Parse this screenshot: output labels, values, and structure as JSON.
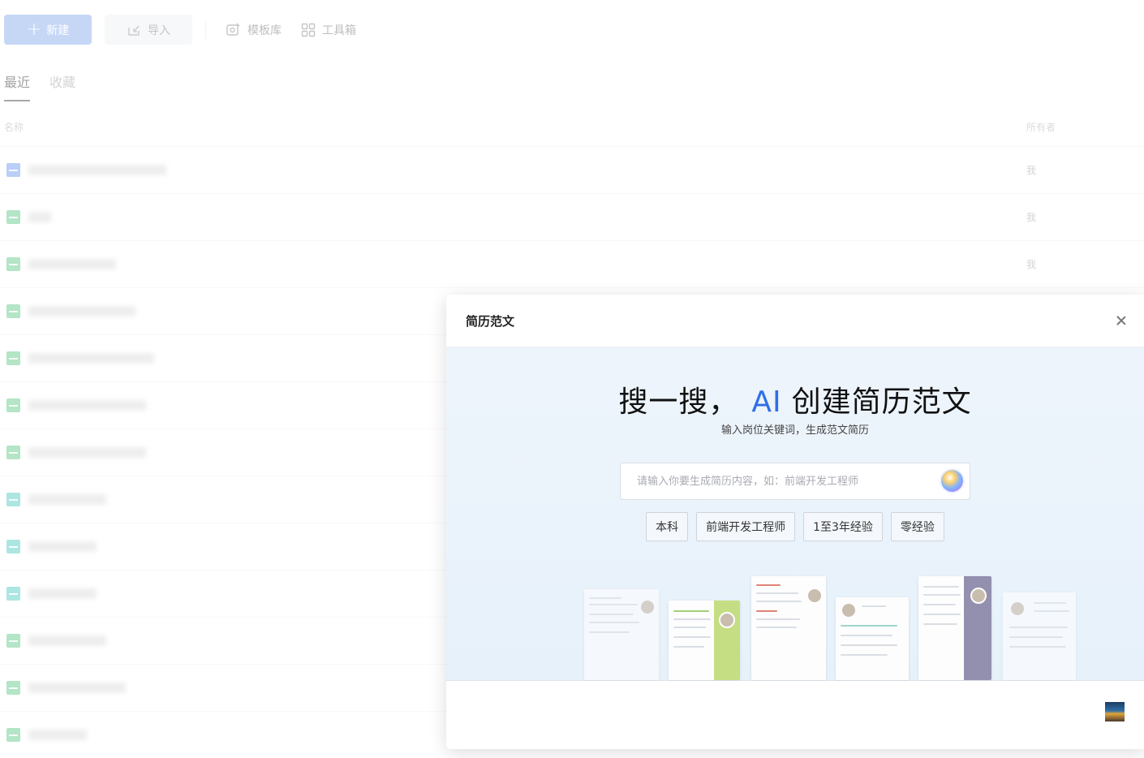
{
  "toolbar": {
    "new_label": "新建",
    "import_label": "导入",
    "templates_label": "模板库",
    "toolbox_label": "工具箱"
  },
  "tabs": [
    {
      "label": "最近",
      "active": true
    },
    {
      "label": "收藏",
      "active": false
    }
  ],
  "list": {
    "col_name": "名称",
    "col_owner": "所有者",
    "rows": [
      {
        "icon": "doc-file-icon",
        "owner": "我"
      },
      {
        "icon": "sheet-file-icon",
        "owner": "我"
      },
      {
        "icon": "sheet-file-icon",
        "owner": "我"
      },
      {
        "icon": "sheet-file-icon",
        "owner": ""
      },
      {
        "icon": "sheet-file-icon",
        "owner": ""
      },
      {
        "icon": "sheet-file-icon",
        "owner": ""
      },
      {
        "icon": "sheet-file-icon",
        "owner": ""
      },
      {
        "icon": "mindmap-file-icon",
        "owner": ""
      },
      {
        "icon": "mindmap-file-icon",
        "owner": ""
      },
      {
        "icon": "mindmap-file-icon",
        "owner": ""
      },
      {
        "icon": "sheet-file-icon",
        "owner": ""
      },
      {
        "icon": "sheet-file-icon",
        "owner": ""
      },
      {
        "icon": "sheet-file-icon",
        "owner": ""
      }
    ]
  },
  "modal": {
    "title": "简历范文",
    "headline_pre": "搜一搜，",
    "headline_ai": "AI",
    "headline_post": "创建简历范文",
    "subtitle": "输入岗位关键词，生成范文简历",
    "search_placeholder": "请输入你要生成简历内容，如：前端开发工程师",
    "search_value": "",
    "chips": [
      "本科",
      "前端开发工程师",
      "1至3年经验",
      "零经验"
    ]
  },
  "colors": {
    "primary": "#2e6fe8",
    "new_button": "#7aa2ec"
  }
}
